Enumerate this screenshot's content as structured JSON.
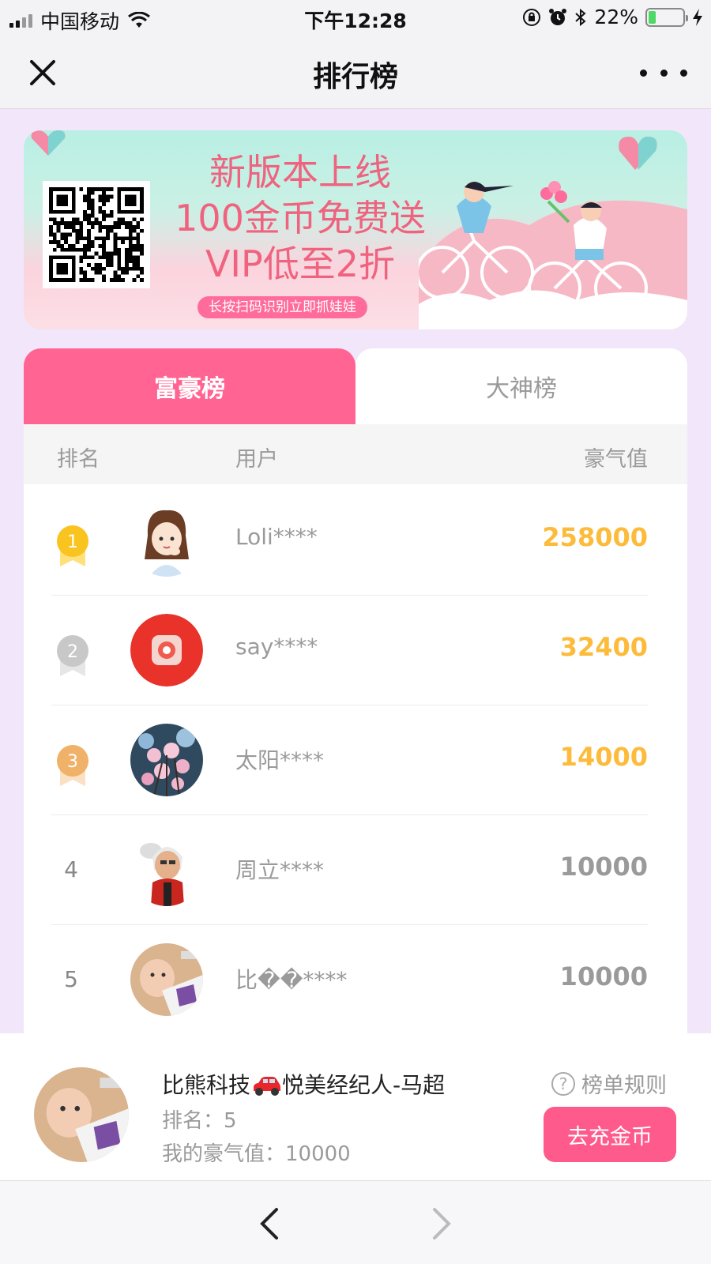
{
  "status_bar": {
    "carrier": "中国移动",
    "time": "下午12:28",
    "battery": "22%",
    "battery_level": 0.22
  },
  "nav": {
    "title": "排行榜"
  },
  "banner": {
    "line1": "新版本上线",
    "line2": "100金币免费送",
    "line3": "VIP低至2折",
    "pill": "长按扫码识别立即抓娃娃"
  },
  "tabs": [
    {
      "label": "富豪榜",
      "active": true
    },
    {
      "label": "大神榜",
      "active": false
    }
  ],
  "list_header": {
    "rank": "排名",
    "user": "用户",
    "score": "豪气值"
  },
  "rows": [
    {
      "rank": "1",
      "name": "Loli****",
      "score": "258000",
      "medal": "gold"
    },
    {
      "rank": "2",
      "name": "say****",
      "score": "32400",
      "medal": "silver"
    },
    {
      "rank": "3",
      "name": "太阳****",
      "score": "14000",
      "medal": "bronze"
    },
    {
      "rank": "4",
      "name": "周立****",
      "score": "10000"
    },
    {
      "rank": "5",
      "name": "比��****",
      "score": "10000"
    }
  ],
  "me": {
    "name_prefix": "比熊科技",
    "name_suffix": "悦美经纪人-马超",
    "rank": "排名：5",
    "score": "我的豪气值：10000"
  },
  "footer": {
    "rules": "榜单规则",
    "recharge": "去充金币"
  },
  "colors": {
    "accent_pink": "#ff6492",
    "gold": "#fcbb3a",
    "page_bg": "#f2e6fb"
  }
}
